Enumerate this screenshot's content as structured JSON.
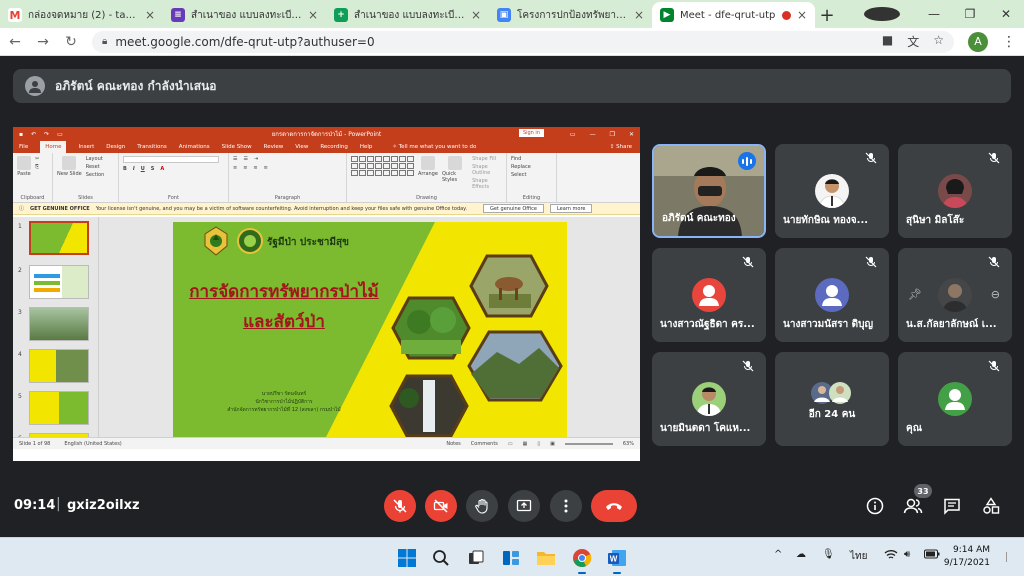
{
  "browser": {
    "tabs": [
      {
        "label": "กล่องจดหมาย (2) - tatsina52",
        "icon": "gmail-icon",
        "color": "#ea4335",
        "active": false
      },
      {
        "label": "สำเนาของ แบบลงทะเบียนเข้าร่",
        "icon": "google-forms-icon",
        "color": "#673ab7",
        "active": false
      },
      {
        "label": "สำเนาของ แบบลงทะเบียนเข้าร่",
        "icon": "google-sheets-icon",
        "color": "#0f9d58",
        "active": false
      },
      {
        "label": "โครงการปกป้องทรัพยากรป่าและ",
        "icon": "google-classroom-icon",
        "color": "#4285f4",
        "active": false
      },
      {
        "label": "Meet - dfe-qrut-utp",
        "icon": "google-meet-icon",
        "color": "#00832d",
        "active": true
      }
    ],
    "url": "meet.google.com/dfe-qrut-utp?authuser=0",
    "profile_initial": "A"
  },
  "presenter": {
    "text": "อภิรัตน์ คณะทอง กำลังนำเสนอ"
  },
  "powerpoint": {
    "title": "ยกรดาดการกาจัดการป่าไม้ - PowerPoint",
    "signin": "Sign in",
    "menu": [
      "File",
      "Home",
      "Insert",
      "Design",
      "Transitions",
      "Animations",
      "Slide Show",
      "Review",
      "View",
      "Recording",
      "Help"
    ],
    "tell_me": "Tell me what you want to do",
    "share": "Share",
    "ribbon": {
      "paste": "Paste",
      "clipboard": "Clipboard",
      "new_slide": "New Slide",
      "layout": "Layout",
      "reset": "Reset",
      "section": "Section",
      "slides": "Slides",
      "font": "Font",
      "paragraph": "Paragraph",
      "drawing": "Drawing",
      "arrange": "Arrange",
      "quick_styles": "Quick Styles",
      "shape_fill": "Shape Fill",
      "shape_outline": "Shape Outline",
      "shape_effects": "Shape Effects",
      "find": "Find",
      "replace": "Replace",
      "select": "Select",
      "editing": "Editing"
    },
    "license": {
      "heading": "GET GENUINE OFFICE",
      "message": "Your license isn't genuine, and you may be a victim of software counterfeiting. Avoid interruption and keep your files safe with genuine Office today.",
      "btn_genuine": "Get genuine Office",
      "btn_learn": "Learn more"
    },
    "thumb_numbers": [
      "1",
      "2",
      "3",
      "4",
      "5",
      "6"
    ],
    "status": {
      "slide_count": "Slide 1 of 98",
      "language": "English (United States)",
      "notes": "Notes",
      "comments": "Comments",
      "zoom": "63%"
    },
    "slide": {
      "slogan": "รัฐมีป่า ประชามีสุข",
      "title_line1": "การจัดการทรัพยากรป่าไม้",
      "title_line2": "และสัตว์ป่า",
      "credit_line1": "นายปรีชา รัตนจันทร์",
      "credit_line2": "นักวิชาการป่าไม้ปฏิบัติการ",
      "credit_line3": "สำนักจัดการทรัพยากรป่าไม้ที่ 12 (สงขลา) กรมป่าไม้"
    }
  },
  "participants": [
    {
      "name": "อภิรัตน์ คณะทอง",
      "camera": true,
      "speaking": true
    },
    {
      "name": "นายทักษิณ ทองจ...",
      "avatar_type": "photo"
    },
    {
      "name": "สุนิษา มิลโส๊ะ",
      "avatar_type": "photo"
    },
    {
      "name": "นางสาวณัฐธิดา คร...",
      "avatar_type": "initial",
      "avatar_color": "#e8453c"
    },
    {
      "name": "นางสาวมนัสรา ดิบุญ",
      "avatar_type": "initial",
      "avatar_color": "#5c6bc0"
    },
    {
      "name": "น.ส.กัลยาลักษณ์ เ...",
      "avatar_type": "photo"
    },
    {
      "name": "นายมินตดา โคแห...",
      "avatar_type": "photo"
    },
    {
      "name": "อีก 24 คน",
      "avatar_type": "group"
    },
    {
      "name": "คุณ",
      "avatar_type": "initial",
      "avatar_color": "#43a047"
    }
  ],
  "meeting": {
    "time": "09:14",
    "separator": "|",
    "code": "gxiz2oilxz",
    "people_count": "33"
  },
  "taskbar": {
    "clock_time": "9:14 AM",
    "clock_date": "9/17/2021",
    "lang": "ไทย"
  }
}
